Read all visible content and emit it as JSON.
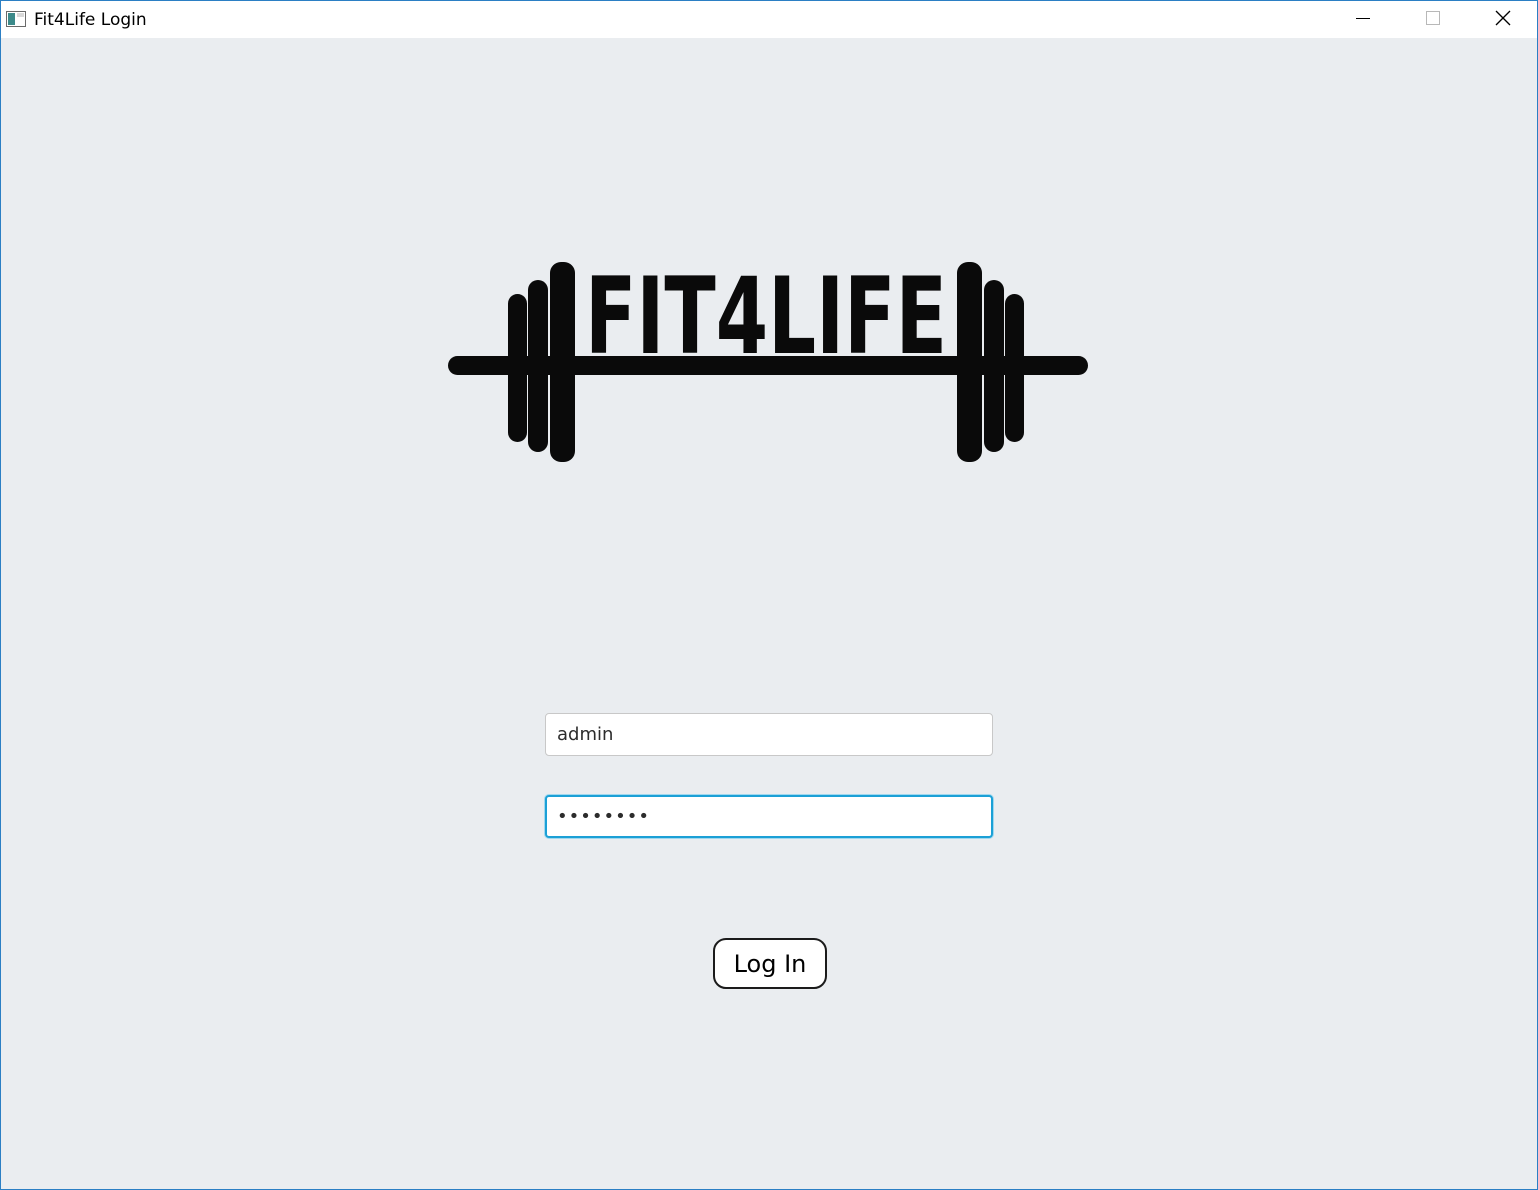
{
  "window": {
    "title": "Fit4Life Login",
    "icon": "app-window-icon",
    "controls": {
      "minimize_icon": "minimize-icon",
      "maximize_icon": "maximize-icon",
      "close_icon": "close-icon"
    }
  },
  "logo": {
    "wordmark": "FIT4LIFE",
    "icon": "barbell-icon"
  },
  "login_form": {
    "username_value": "admin",
    "password_value": "••••••••",
    "login_button_label": "Log In"
  },
  "colors": {
    "background": "#eaedf0",
    "focus_border": "#1ba0d6",
    "window_border": "#2b7fc4",
    "logo": "#0a0a0a"
  }
}
